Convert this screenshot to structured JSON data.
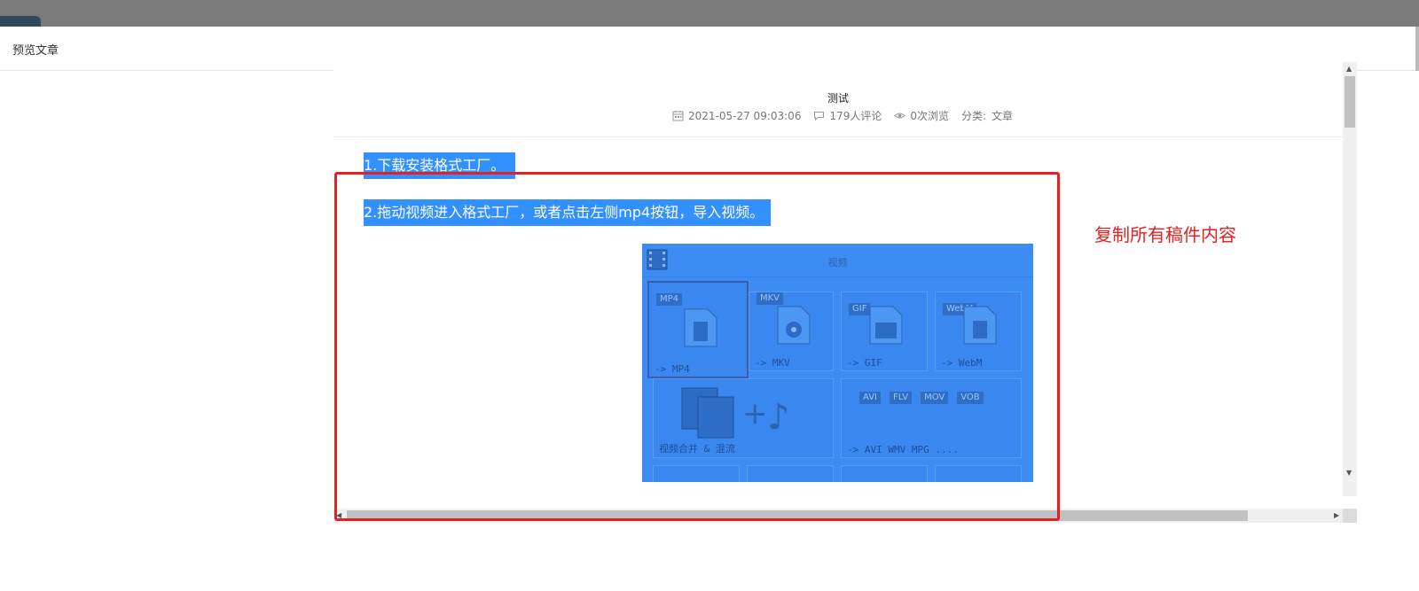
{
  "modal": {
    "title": "预览文章"
  },
  "article": {
    "title": "测试",
    "meta": {
      "date": "2021-05-27 09:03:06",
      "comments": "179人评论",
      "views": "0次浏览",
      "category_label": "分类:",
      "category_value": "文章"
    },
    "paragraphs": [
      "1.下载安装格式工厂。",
      "2.拖动视频进入格式工厂，或者点击左侧mp4按钮，导入视频。"
    ],
    "screenshot": {
      "title": "视频",
      "tiles": [
        {
          "badge": "MP4",
          "label": "-> MP4"
        },
        {
          "badge": "MKV",
          "label": "-> MKV"
        },
        {
          "badge": "GIF",
          "label": "-> GIF"
        },
        {
          "badge": "WebM",
          "label": "-> WebM"
        }
      ],
      "merge_label": "视频合并 & 混流",
      "multi_badges": [
        "AVI",
        "FLV",
        "MOV",
        "VOB"
      ],
      "multi_label": "-> AVI WMV MPG ...."
    }
  },
  "annotation": {
    "text": "复制所有稿件内容",
    "color": "#e62020"
  },
  "colors": {
    "selection": "#3390ff",
    "highlight_box": "#e62020"
  }
}
